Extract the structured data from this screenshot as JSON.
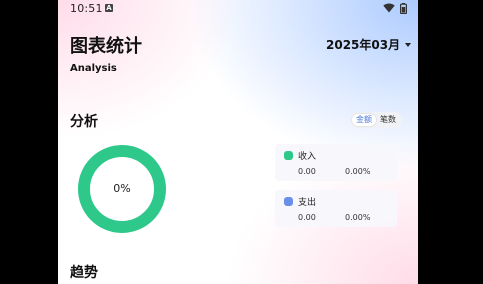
{
  "status_bar": {
    "time": "10:51",
    "notification_badge": "A"
  },
  "header": {
    "title": "图表统计",
    "subtitle": "Analysis",
    "month": "2025年03月"
  },
  "analysis": {
    "title": "分析",
    "toggle_options": [
      "金额",
      "笔数"
    ],
    "selected_option": "金额",
    "donut_center_label": "0%",
    "donut_color": "#2ec98a",
    "legend": [
      {
        "name": "收入",
        "amount": "0.00",
        "percent": "0.00%",
        "color": "#2ec98a"
      },
      {
        "name": "支出",
        "amount": "0.00",
        "percent": "0.00%",
        "color": "#6a8fe8"
      }
    ]
  },
  "trend": {
    "title": "趋势"
  }
}
